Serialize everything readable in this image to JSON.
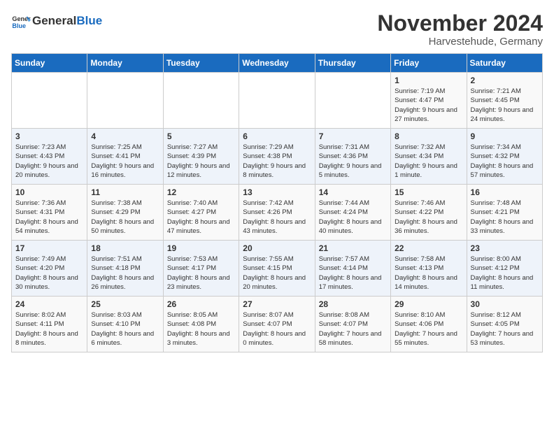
{
  "logo": {
    "text_general": "General",
    "text_blue": "Blue"
  },
  "title": {
    "month": "November 2024",
    "location": "Harvestehude, Germany"
  },
  "headers": [
    "Sunday",
    "Monday",
    "Tuesday",
    "Wednesday",
    "Thursday",
    "Friday",
    "Saturday"
  ],
  "weeks": [
    [
      {
        "day": "",
        "info": ""
      },
      {
        "day": "",
        "info": ""
      },
      {
        "day": "",
        "info": ""
      },
      {
        "day": "",
        "info": ""
      },
      {
        "day": "",
        "info": ""
      },
      {
        "day": "1",
        "info": "Sunrise: 7:19 AM\nSunset: 4:47 PM\nDaylight: 9 hours and 27 minutes."
      },
      {
        "day": "2",
        "info": "Sunrise: 7:21 AM\nSunset: 4:45 PM\nDaylight: 9 hours and 24 minutes."
      }
    ],
    [
      {
        "day": "3",
        "info": "Sunrise: 7:23 AM\nSunset: 4:43 PM\nDaylight: 9 hours and 20 minutes."
      },
      {
        "day": "4",
        "info": "Sunrise: 7:25 AM\nSunset: 4:41 PM\nDaylight: 9 hours and 16 minutes."
      },
      {
        "day": "5",
        "info": "Sunrise: 7:27 AM\nSunset: 4:39 PM\nDaylight: 9 hours and 12 minutes."
      },
      {
        "day": "6",
        "info": "Sunrise: 7:29 AM\nSunset: 4:38 PM\nDaylight: 9 hours and 8 minutes."
      },
      {
        "day": "7",
        "info": "Sunrise: 7:31 AM\nSunset: 4:36 PM\nDaylight: 9 hours and 5 minutes."
      },
      {
        "day": "8",
        "info": "Sunrise: 7:32 AM\nSunset: 4:34 PM\nDaylight: 9 hours and 1 minute."
      },
      {
        "day": "9",
        "info": "Sunrise: 7:34 AM\nSunset: 4:32 PM\nDaylight: 8 hours and 57 minutes."
      }
    ],
    [
      {
        "day": "10",
        "info": "Sunrise: 7:36 AM\nSunset: 4:31 PM\nDaylight: 8 hours and 54 minutes."
      },
      {
        "day": "11",
        "info": "Sunrise: 7:38 AM\nSunset: 4:29 PM\nDaylight: 8 hours and 50 minutes."
      },
      {
        "day": "12",
        "info": "Sunrise: 7:40 AM\nSunset: 4:27 PM\nDaylight: 8 hours and 47 minutes."
      },
      {
        "day": "13",
        "info": "Sunrise: 7:42 AM\nSunset: 4:26 PM\nDaylight: 8 hours and 43 minutes."
      },
      {
        "day": "14",
        "info": "Sunrise: 7:44 AM\nSunset: 4:24 PM\nDaylight: 8 hours and 40 minutes."
      },
      {
        "day": "15",
        "info": "Sunrise: 7:46 AM\nSunset: 4:22 PM\nDaylight: 8 hours and 36 minutes."
      },
      {
        "day": "16",
        "info": "Sunrise: 7:48 AM\nSunset: 4:21 PM\nDaylight: 8 hours and 33 minutes."
      }
    ],
    [
      {
        "day": "17",
        "info": "Sunrise: 7:49 AM\nSunset: 4:20 PM\nDaylight: 8 hours and 30 minutes."
      },
      {
        "day": "18",
        "info": "Sunrise: 7:51 AM\nSunset: 4:18 PM\nDaylight: 8 hours and 26 minutes."
      },
      {
        "day": "19",
        "info": "Sunrise: 7:53 AM\nSunset: 4:17 PM\nDaylight: 8 hours and 23 minutes."
      },
      {
        "day": "20",
        "info": "Sunrise: 7:55 AM\nSunset: 4:15 PM\nDaylight: 8 hours and 20 minutes."
      },
      {
        "day": "21",
        "info": "Sunrise: 7:57 AM\nSunset: 4:14 PM\nDaylight: 8 hours and 17 minutes."
      },
      {
        "day": "22",
        "info": "Sunrise: 7:58 AM\nSunset: 4:13 PM\nDaylight: 8 hours and 14 minutes."
      },
      {
        "day": "23",
        "info": "Sunrise: 8:00 AM\nSunset: 4:12 PM\nDaylight: 8 hours and 11 minutes."
      }
    ],
    [
      {
        "day": "24",
        "info": "Sunrise: 8:02 AM\nSunset: 4:11 PM\nDaylight: 8 hours and 8 minutes."
      },
      {
        "day": "25",
        "info": "Sunrise: 8:03 AM\nSunset: 4:10 PM\nDaylight: 8 hours and 6 minutes."
      },
      {
        "day": "26",
        "info": "Sunrise: 8:05 AM\nSunset: 4:08 PM\nDaylight: 8 hours and 3 minutes."
      },
      {
        "day": "27",
        "info": "Sunrise: 8:07 AM\nSunset: 4:07 PM\nDaylight: 8 hours and 0 minutes."
      },
      {
        "day": "28",
        "info": "Sunrise: 8:08 AM\nSunset: 4:07 PM\nDaylight: 7 hours and 58 minutes."
      },
      {
        "day": "29",
        "info": "Sunrise: 8:10 AM\nSunset: 4:06 PM\nDaylight: 7 hours and 55 minutes."
      },
      {
        "day": "30",
        "info": "Sunrise: 8:12 AM\nSunset: 4:05 PM\nDaylight: 7 hours and 53 minutes."
      }
    ]
  ]
}
